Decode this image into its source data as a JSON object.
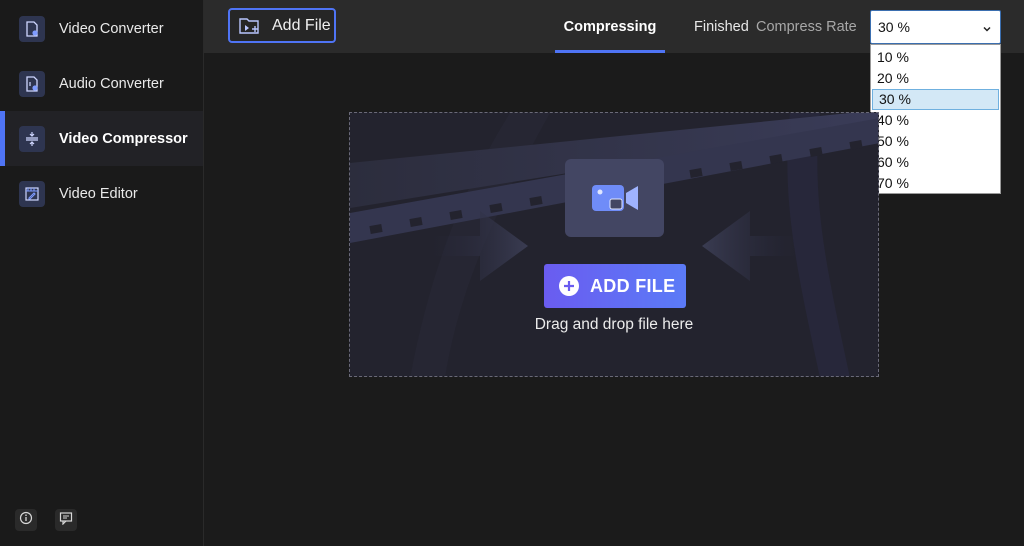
{
  "sidebar": {
    "items": [
      {
        "label": "Video Converter",
        "icon": "video-file-icon"
      },
      {
        "label": "Audio Converter",
        "icon": "audio-file-icon"
      },
      {
        "label": "Video Compressor",
        "icon": "compress-icon",
        "active": true
      },
      {
        "label": "Video Editor",
        "icon": "video-edit-icon"
      }
    ],
    "footer": [
      {
        "icon": "info-icon"
      },
      {
        "icon": "feedback-icon"
      }
    ]
  },
  "header": {
    "add_file_label": "Add File",
    "tabs": [
      {
        "label": "Compressing",
        "active": true
      },
      {
        "label": "Finished",
        "active": false
      }
    ],
    "compress_rate_label": "Compress Rate",
    "compress_rate_value": "30 %",
    "compress_rate_options": [
      "10 %",
      "20 %",
      "30 %",
      "40 %",
      "50 %",
      "60 %",
      "70 %"
    ]
  },
  "dropzone": {
    "button_label": "ADD FILE",
    "hint": "Drag and drop file here"
  },
  "colors": {
    "accent": "#4f74f5",
    "button_gradient_start": "#6a5cf0",
    "button_gradient_end": "#5b7bf7",
    "background": "#1b1b1b",
    "header": "#2b2b2b"
  }
}
